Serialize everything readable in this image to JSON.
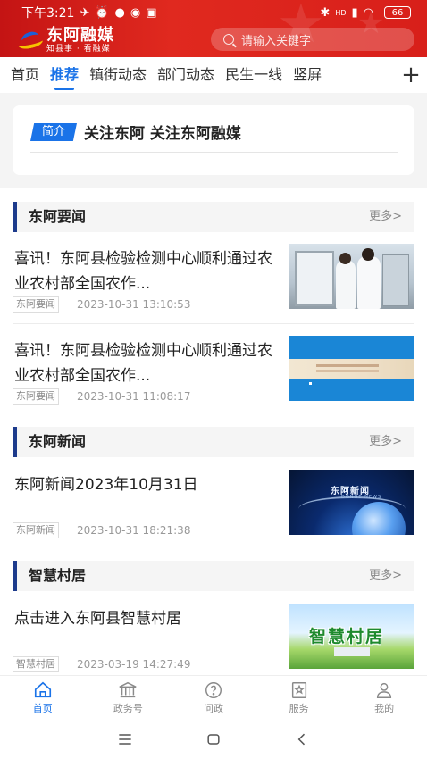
{
  "status_bar": {
    "time": "下午3:21",
    "network": "HD",
    "battery": "66"
  },
  "header": {
    "app_name": "东阿融媒",
    "slogan": "知县事 · 看融媒",
    "search_placeholder": "请输入关键字"
  },
  "tabs": [
    {
      "label": "首页",
      "active": false
    },
    {
      "label": "推荐",
      "active": true
    },
    {
      "label": "镇街动态",
      "active": false
    },
    {
      "label": "部门动态",
      "active": false
    },
    {
      "label": "民生一线",
      "active": false
    },
    {
      "label": "竖屏",
      "active": false
    }
  ],
  "intro": {
    "badge": "简介",
    "title": "关注东阿 关注东阿融媒"
  },
  "sections": [
    {
      "title": "东阿要闻",
      "more": "更多>",
      "items": [
        {
          "title": "喜讯！东阿县检验检测中心顺利通过农业农村部全国农作...",
          "tag": "东阿要闻",
          "date": "2023-10-31 13:10:53"
        },
        {
          "title": "喜讯！东阿县检验检测中心顺利通过农业农村部全国农作...",
          "tag": "东阿要闻",
          "date": "2023-10-31 11:08:17"
        }
      ]
    },
    {
      "title": "东阿新闻",
      "more": "更多>",
      "items": [
        {
          "title": "东阿新闻2023年10月31日",
          "tag": "东阿新闻",
          "date": "2023-10-31 18:21:38",
          "thumb_text": "东阿新闻",
          "thumb_sub": "DONGE NEWS"
        }
      ]
    },
    {
      "title": "智慧村居",
      "more": "更多>",
      "items": [
        {
          "title": "点击进入东阿县智慧村居",
          "tag": "智慧村居",
          "date": "2023-03-19 14:27:49",
          "thumb_text": "智慧村居"
        }
      ]
    }
  ],
  "bottom_nav": [
    {
      "label": "首页",
      "icon": "home-icon",
      "active": true
    },
    {
      "label": "政务号",
      "icon": "government-icon",
      "active": false
    },
    {
      "label": "问政",
      "icon": "question-icon",
      "active": false
    },
    {
      "label": "服务",
      "icon": "service-star-icon",
      "active": false
    },
    {
      "label": "我的",
      "icon": "profile-icon",
      "active": false
    }
  ],
  "colors": {
    "header_red": "#d81f1a",
    "accent_blue": "#1a73e8",
    "section_bar": "#1d3b8c"
  }
}
